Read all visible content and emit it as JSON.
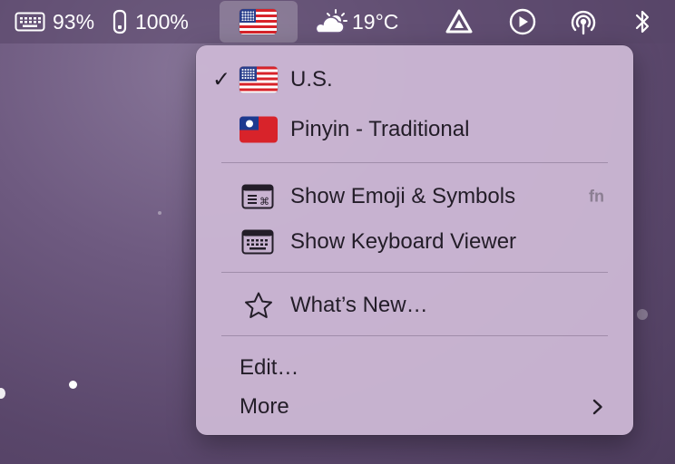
{
  "menubar": {
    "keyboard_battery": "93%",
    "device_battery": "100%",
    "input_source_icon": "us-flag-icon",
    "weather_temp": "19°C",
    "weather_icon": "partly-sunny-icon",
    "status_icons": [
      "app-triangle-icon",
      "play-circle-icon",
      "airdrop-broadcast-icon",
      "bluetooth-icon"
    ]
  },
  "menu": {
    "input_sources": [
      {
        "label": "U.S.",
        "checked": true,
        "icon": "us-flag-icon"
      },
      {
        "label": "Pinyin - Traditional",
        "checked": false,
        "icon": "taiwan-flag-icon"
      }
    ],
    "emoji": {
      "label": "Show Emoji & Symbols",
      "shortcut": "fn",
      "icon": "emoji-viewer-icon"
    },
    "keyboard_viewer": {
      "label": "Show Keyboard Viewer",
      "icon": "keyboard-viewer-icon"
    },
    "whats_new": {
      "label": "What’s New…",
      "icon": "star-icon"
    },
    "edit": {
      "label": "Edit…"
    },
    "more": {
      "label": "More",
      "icon": "chevron-right-icon"
    },
    "checkmark": "✓"
  },
  "colors": {
    "menu_bg": "#cbb6d3",
    "menubar_bg": "#584668",
    "wallpaper": "#6e5a80"
  }
}
